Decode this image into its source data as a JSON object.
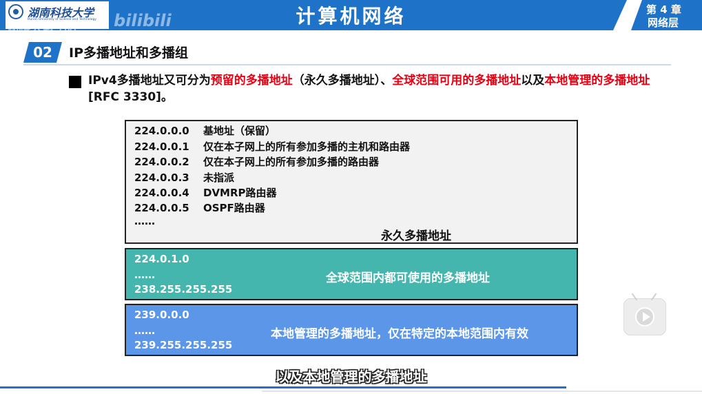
{
  "header": {
    "logo_cn": "湖南科技大学",
    "logo_en": "Hunan University of Science and Technology",
    "watermark": "湖科大教书匠",
    "watermark_bili": "bilibili",
    "title": "计算机网络",
    "chapter_line1": "第 4 章",
    "chapter_line2": "网络层"
  },
  "section": {
    "number": "02",
    "title": "IP多播地址和多播组"
  },
  "paragraph": {
    "p1": "IPv4多播地址又可分为",
    "r1": "预留的多播地址",
    "p2": "（永久多播地址）、",
    "r2": "全球范围可用的多播地址",
    "p3": "以及",
    "r3": "本地管理的多播地址",
    "p4": "[RFC 3330]。"
  },
  "permanent": {
    "rows": [
      {
        "addr": "224.0.0.0",
        "desc": "基地址（保留）"
      },
      {
        "addr": "224.0.0.1",
        "desc": "仅在本子网上的所有参加多播的主机和路由器"
      },
      {
        "addr": "224.0.0.2",
        "desc": "仅在本子网上的所有参加多播的路由器"
      },
      {
        "addr": "224.0.0.3",
        "desc": "未指派"
      },
      {
        "addr": "224.0.0.4",
        "desc": "DVMRP路由器"
      },
      {
        "addr": "224.0.0.5",
        "desc": "OSPF路由器"
      }
    ],
    "ellipsis": "……",
    "label": "永久多播地址"
  },
  "global": {
    "start": "224.0.1.0",
    "ellipsis": "……",
    "end": "238.255.255.255",
    "label": "全球范围内都可使用的多播地址",
    "color": "#45b6ad"
  },
  "local": {
    "start": "239.0.0.0",
    "ellipsis": "……",
    "end": "239.255.255.255",
    "label": "本地管理的多播地址，仅在特定的本地范围内有效",
    "color": "#5b96e8"
  },
  "subtitle": "以及本地管理的多播地址",
  "colors": {
    "header_blue": "#1e73c8",
    "highlight_red": "#e60012"
  },
  "icons": {
    "play": "play-button-icon",
    "university": "university-emblem-icon"
  }
}
